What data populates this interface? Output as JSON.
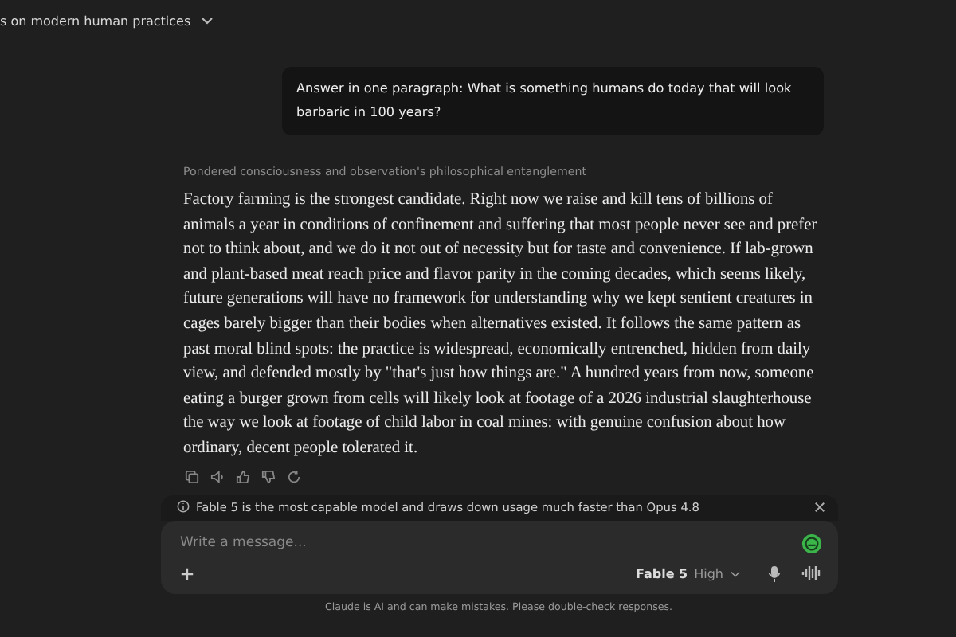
{
  "conversation_title": "s on modern human practices",
  "user_message": "Answer in one paragraph: What is something humans do today that will look barbaric in 100 years?",
  "thinking_summary": "Pondered consciousness and observation's philosophical entanglement",
  "response": "Factory farming is the strongest candidate. Right now we raise and kill tens of billions of animals a year in conditions of confinement and suffering that most people never see and prefer not to think about, and we do it not out of necessity but for taste and convenience. If lab-grown and plant-based meat reach price and flavor parity in the coming decades, which seems likely, future generations will have no framework for understanding why we kept sentient creatures in cages barely bigger than their bodies when alternatives existed. It follows the same pattern as past moral blind spots: the practice is widespread, economically entrenched, hidden from daily view, and defended mostly by \"that's just how things are.\" A hundred years from now, someone eating a burger grown from cells will likely look at footage of a 2026 industrial slaughterhouse the way we look at footage of child labor in coal mines: with genuine confusion about how ordinary, decent people tolerated it.",
  "notice": "Fable 5 is the most capable model and draws down usage much faster than Opus 4.8",
  "composer": {
    "placeholder": "Write a message...",
    "model": "Fable 5",
    "effort": "High"
  },
  "disclaimer": "Claude is AI and can make mistakes. Please double-check responses."
}
